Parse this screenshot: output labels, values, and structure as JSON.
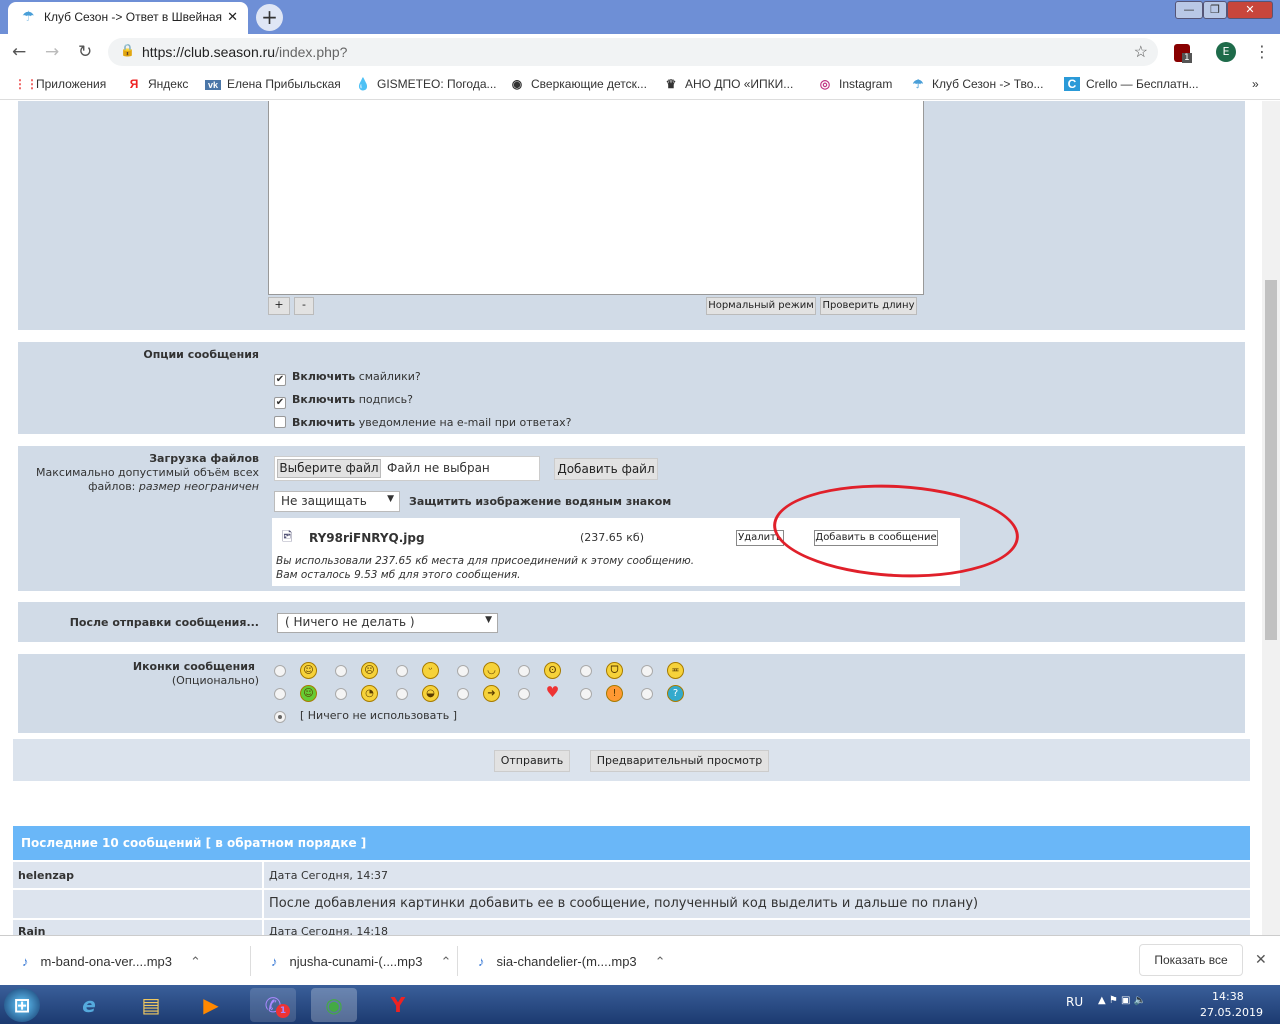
{
  "browser": {
    "tab_title": "Клуб Сезон -> Ответ в Швейная",
    "url_host": "https://club.season.ru",
    "url_path": "/index.php?",
    "ext_badge": "1",
    "profile_initial": "E",
    "bookmarks": [
      "Приложения",
      "Яндекс",
      "Елена Прибыльская",
      "GISMETEO: Погода...",
      "Сверкающие детск...",
      "АНО ДПО «ИПКИ...",
      "Instagram",
      "Клуб Сезон -> Тво...",
      "Crello — Бесплатн..."
    ],
    "more": "»"
  },
  "editor": {
    "plus": "+",
    "minus": "-",
    "normal_mode": "Нормальный режим",
    "check_length": "Проверить длину"
  },
  "options": {
    "title": "Опции сообщения",
    "items": [
      {
        "bold": "Включить",
        "rest": " смайлики?",
        "checked": true
      },
      {
        "bold": "Включить",
        "rest": " подпись?",
        "checked": true
      },
      {
        "bold": "Включить",
        "rest": " уведомление на e-mail при ответах?",
        "checked": false
      }
    ]
  },
  "upload": {
    "title": "Загрузка файлов",
    "note1": "Максимально допустимый объём всех",
    "note2": "файлов: ",
    "note_italic": "размер неограничен",
    "choose": "Выберите файл",
    "no_file": "Файл не выбран",
    "add_file": "Добавить файл",
    "protect_select": "Не защищать",
    "protect_label": "Защитить изображение водяным знаком",
    "file_name": "RY98riFNRYQ.jpg",
    "file_size": "(237.65 кб)",
    "delete": "Удалить",
    "add_to_message": "Добавить в сообщение",
    "used": "Вы использовали 237.65 кб места для присоединений к этому сообщению.",
    "left": "Вам осталось 9.53 мб для этого сообщения.",
    "annotation_color": "#e0202a"
  },
  "after": {
    "title": "После отправки сообщения...",
    "value": "( Ничего не делать )"
  },
  "icons": {
    "title": "Иконки сообщения",
    "subtitle": "(Опционально)",
    "none": "[ Ничего не использовать ]",
    "row1": [
      "☺",
      "☹",
      "ᵕ",
      "◡",
      "ʘ",
      "ᗜ",
      "≖"
    ],
    "row2": [
      "☺",
      "◔",
      "◒",
      "➜",
      "♥",
      "!",
      "?"
    ]
  },
  "actions": {
    "submit": "Отправить",
    "preview": "Предварительный просмотр"
  },
  "recent": {
    "title": "Последние 10 сообщений [ в обратном порядке ]",
    "posts": [
      {
        "author": "helenzap",
        "date": "Дата Сегодня, 14:37",
        "text": "После добавления картинки добавить ее в сообщение, полученный код выделить и дальше по плану)"
      },
      {
        "author": "Rain",
        "date": "Дата Сегодня, 14:18"
      }
    ]
  },
  "downloads": {
    "items": [
      "m-band-ona-ver....mp3",
      "njusha-cunami-(....mp3",
      "sia-chandelier-(m....mp3"
    ],
    "show_all": "Показать все",
    "close": "✕"
  },
  "taskbar": {
    "lang": "RU",
    "time": "14:38",
    "date": "27.05.2019",
    "viber_badge": "1"
  }
}
